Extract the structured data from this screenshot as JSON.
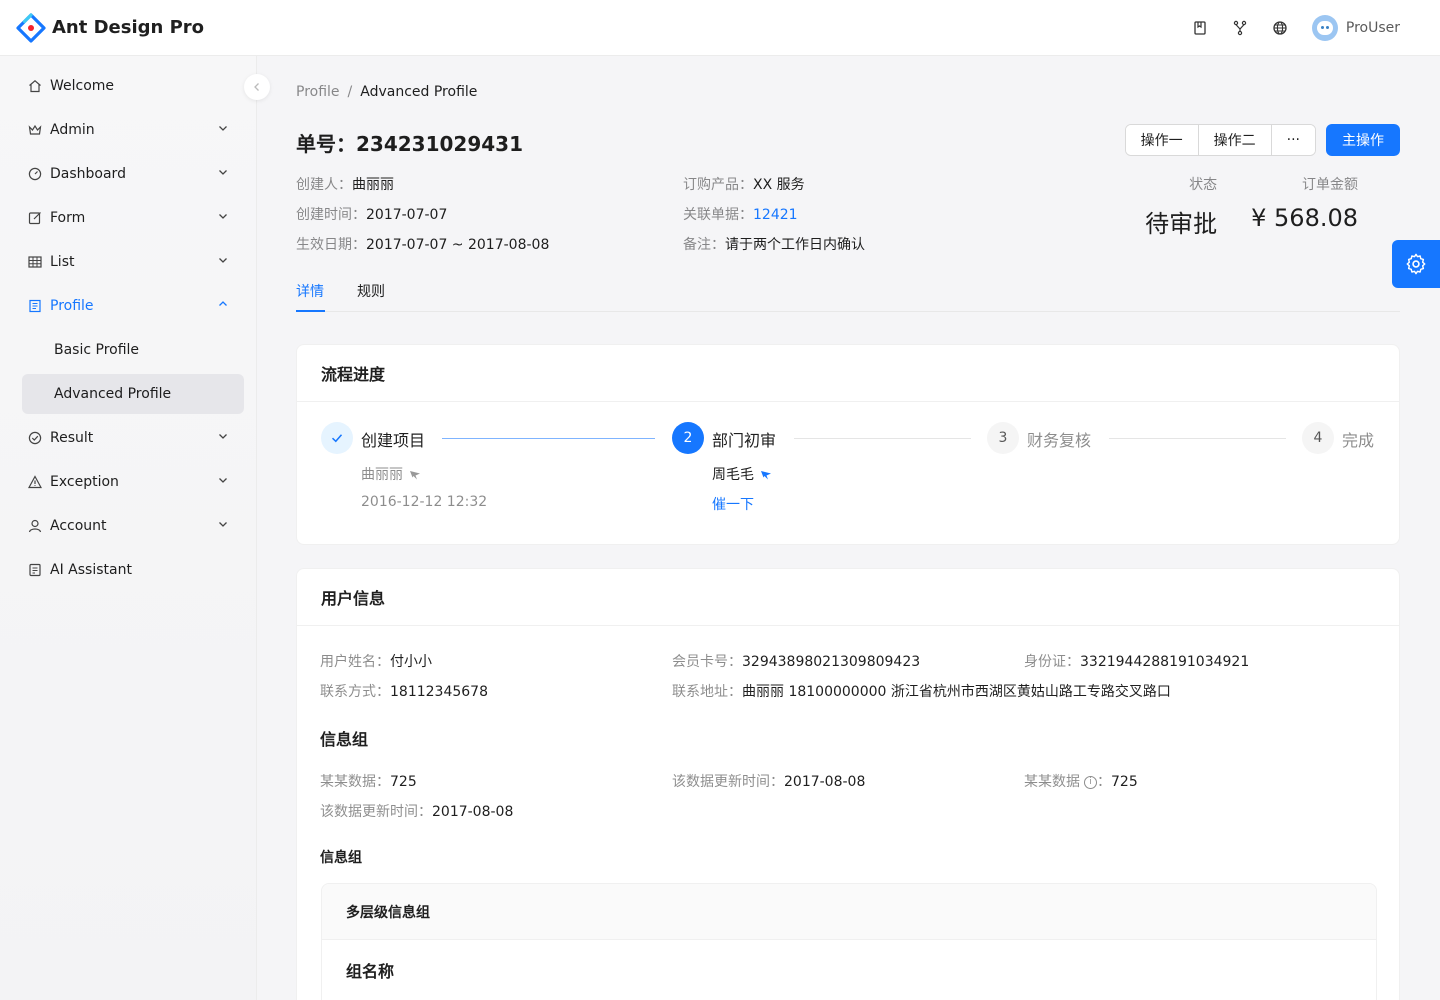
{
  "app": {
    "title": "Ant Design Pro",
    "user_name": "ProUser"
  },
  "header": {
    "icons": [
      "doc-icon",
      "fork-icon",
      "globe-icon"
    ]
  },
  "sidebar": {
    "items": [
      {
        "label": "Welcome",
        "icon": "home-icon"
      },
      {
        "label": "Admin",
        "icon": "crown-icon"
      },
      {
        "label": "Dashboard",
        "icon": "dashboard-icon"
      },
      {
        "label": "Form",
        "icon": "form-icon"
      },
      {
        "label": "List",
        "icon": "table-icon"
      },
      {
        "label": "Profile",
        "icon": "profile-icon"
      },
      {
        "label": "Result",
        "icon": "check-circle-icon"
      },
      {
        "label": "Exception",
        "icon": "warning-icon"
      },
      {
        "label": "Account",
        "icon": "user-icon"
      },
      {
        "label": "AI Assistant",
        "icon": "robot-icon"
      }
    ],
    "profile_sub": [
      "Basic Profile",
      "Advanced Profile"
    ]
  },
  "breadcrumb": {
    "parent": "Profile",
    "sep": "/",
    "current": "Advanced Profile"
  },
  "page": {
    "title": "单号：234231029431",
    "actions": {
      "op1": "操作一",
      "op2": "操作二",
      "more": "···",
      "primary": "主操作"
    },
    "desc": {
      "creator_label": "创建人：",
      "creator": "曲丽丽",
      "product_label": "订购产品：",
      "product": "XX 服务",
      "created_label": "创建时间：",
      "created": "2017-07-07",
      "related_label": "关联单据：",
      "related": "12421",
      "effective_label": "生效日期：",
      "effective": "2017-07-07 ~ 2017-08-08",
      "remark_label": "备注：",
      "remark": "请于两个工作日内确认"
    },
    "extra": {
      "status_label": "状态",
      "status": "待审批",
      "amount_label": "订单金额",
      "amount": "¥ 568.08"
    },
    "tabs": [
      "详情",
      "规则"
    ]
  },
  "progress": {
    "title": "流程进度",
    "steps": [
      {
        "num": "",
        "title": "创建项目",
        "person": "曲丽丽",
        "extra": "2016-12-12 12:32"
      },
      {
        "num": "2",
        "title": "部门初审",
        "person": "周毛毛",
        "extra": "催一下"
      },
      {
        "num": "3",
        "title": "财务复核"
      },
      {
        "num": "4",
        "title": "完成"
      }
    ]
  },
  "user_info": {
    "title": "用户信息",
    "name_label": "用户姓名：",
    "name": "付小小",
    "card_label": "会员卡号：",
    "card": "32943898021309809423",
    "id_label": "身份证：",
    "id": "3321944288191034921",
    "phone_label": "联系方式：",
    "phone": "18112345678",
    "addr_label": "联系地址：",
    "addr": "曲丽丽 18100000000 浙江省杭州市西湖区黄姑山路工专路交叉路口",
    "group_title": "信息组",
    "d1_label": "某某数据：",
    "d1": "725",
    "d2_label": "该数据更新时间：",
    "d2": "2017-08-08",
    "d3_label": "某某数据",
    "d3_colon": "：",
    "d3": "725",
    "help_glyph": "i",
    "d4_label": "该数据更新时间：",
    "d4": "2017-08-08",
    "group_title2": "信息组",
    "multi_title": "多层级信息组",
    "group_name": "组名称"
  },
  "colors": {
    "primary": "#1677ff"
  }
}
